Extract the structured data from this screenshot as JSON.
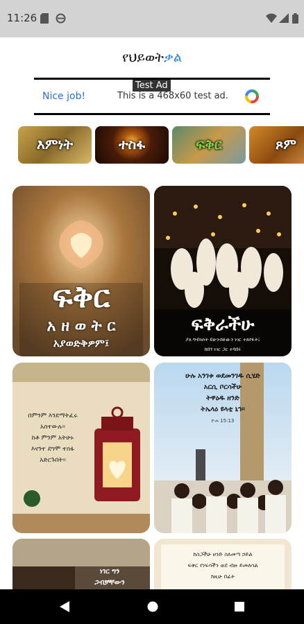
{
  "status_bar": {
    "time": "11:26"
  },
  "header": {
    "title_main": "የህይወት",
    "title_accent": "ቃል"
  },
  "ad": {
    "tag": "Test Ad",
    "left_text": "Nice job!",
    "center_text": "This is a 468x60 test ad."
  },
  "categories": [
    {
      "label": "እምነት"
    },
    {
      "label": "ተስፋ"
    },
    {
      "label": "ፍቅር"
    },
    {
      "label": "ጾም"
    }
  ],
  "posts": [
    {
      "big": "ፍቅር",
      "line2": "አ ዘ ወ ት ር",
      "line3": "አያወድቅዎም፤"
    },
    {
      "big": "ፍቅራችሁ",
      "line2": "ያለ ግብዝነት ይሁን፡ክፉውን ነገር ተጸየፉት፤",
      "line3": "ከበጎ ነገር ጋር ተባበሩ"
    },
    {
      "l1": "በምንም እንደማትፈሩ",
      "l2": "አስተውሉ።",
      "l3": "ከቶ ምንም አትሁኑ",
      "l4": "እናንተ ደግሞ ተስፋ",
      "l5": "አድርጉበት።"
    },
    {
      "l1": "ሁሉ አንገቱ ወደመንገዱ ሲሄድ",
      "l2": "አርሲ ቦርሳችሁ",
      "l3": "ትዋዕዱ ዘንድ",
      "l4": "ትኤላዕ ዩላቲ ኒኅ።",
      "l5": "ዮሐ 15:13"
    },
    {
      "l1": "ነገር ግን",
      "l2": "ጋብቻቸውን"
    },
    {
      "l1": "ከስጋችሁ ዘንድ ስለመጣ ኃይል",
      "l2": "ፍቅር የነፍሳችን ወደ ብዙ ይመለሳል",
      "l3": "ከዚሁ በፊት"
    }
  ]
}
